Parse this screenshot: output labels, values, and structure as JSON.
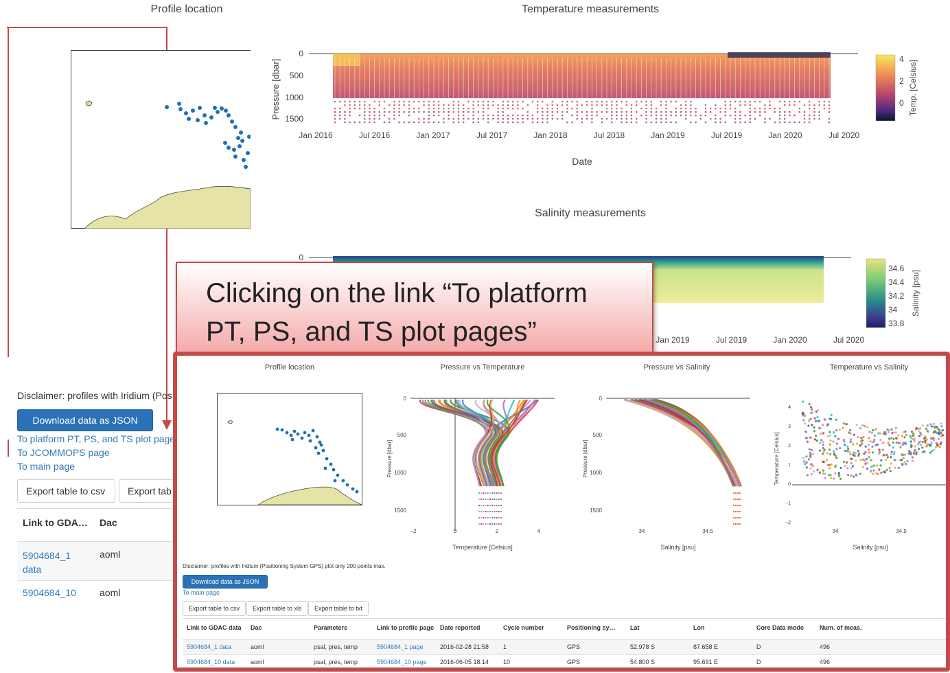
{
  "outer": {
    "map_title": "Profile location",
    "temp_title": "Temperature measurements",
    "temp_xlabel": "Date",
    "temp_ylabel": "Pressure [dbar]",
    "temp_yticks": [
      "0",
      "500",
      "1000",
      "1500"
    ],
    "temp_xticks": [
      "Jan 2016",
      "Jul 2016",
      "Jan 2017",
      "Jul 2017",
      "Jan 2018",
      "Jul 2018",
      "Jan 2019",
      "Jul 2019",
      "Jan 2020",
      "Jul 2020"
    ],
    "temp_colorbar_label": "Temp. [Celsius]",
    "temp_colorbar_ticks": [
      "4",
      "2",
      "0"
    ],
    "sal_title": "Salinity measurements",
    "sal_ytick": "0",
    "sal_xticks": [
      "Jan 2019",
      "Jul 2019",
      "Jan 2020",
      "Jul 2020"
    ],
    "sal_colorbar_label": "Salinity [psu]",
    "sal_colorbar_ticks": [
      "34.6",
      "34.4",
      "34.2",
      "34",
      "33.8"
    ],
    "disclaimer": "Disclaimer: profiles with Iridium (Pos",
    "download_label": "Download data as JSON",
    "link_platform": "To platform PT, PS, and TS plot page",
    "link_jcommops": "To JCOMMOPS page",
    "link_main": "To main page",
    "export_csv": "Export table to csv",
    "export_other": "Export tab",
    "col_link": "Link to GDA…",
    "col_dac": "Dac",
    "row1_link": "5904684_1 data",
    "row1_dac": "aoml",
    "row2_link": "5904684_10",
    "row2_dac": "aoml"
  },
  "callout": {
    "text": "Clicking on the link “To platform PT, PS, and TS plot pages”"
  },
  "inner": {
    "map_title": "Profile location",
    "pt_title": "Pressure vs Temperature",
    "ps_title": "Pressure vs Salinity",
    "ts_title": "Temperature vs Salinity",
    "pt_xlabel": "Temperature [Celsius]",
    "ps_xlabel": "Salinity [psu]",
    "ts_xlabel": "Salinity [psu]",
    "p_ylabel": "Pressure [dbar]",
    "ts_ylabel": "Temperature [Celsius]",
    "p_yticks": [
      "0",
      "500",
      "1000",
      "1500"
    ],
    "pt_xticks": [
      "−2",
      "0",
      "2",
      "4"
    ],
    "ps_xticks": [
      "34",
      "34.5"
    ],
    "ts_xticks": [
      "34",
      "34.5"
    ],
    "ts_yticks": [
      "4",
      "3",
      "2",
      "1",
      "0",
      "−1",
      "−2"
    ],
    "disclaimer": "Disclaimer: profiles with Iridium (Positioning System GPS) plot only 200 points max.",
    "download_label": "Download data as JSON",
    "link_main": "To main page",
    "export_csv": "Export table to csv",
    "export_xls": "Export table to xls",
    "export_txt": "Export table to txt",
    "columns": [
      "Link to GDAC data",
      "Dac",
      "Parameters",
      "Link to profile page",
      "Date reported",
      "Cycle number",
      "Positioning sy…",
      "Lat",
      "Lon",
      "Core Data mode",
      "Num. of meas."
    ],
    "rows": [
      [
        "5904684_1 data",
        "aoml",
        "psal, pres, temp",
        "5904684_1 page",
        "2016-02-28 21:58",
        "1",
        "GPS",
        "52.978 S",
        "87.658 E",
        "D",
        "496"
      ],
      [
        "5904684_10 data",
        "aoml",
        "psal, pres, temp",
        "5904684_10 page",
        "2016-06-05 18:14",
        "10",
        "GPS",
        "54.800 S",
        "95.691 E",
        "D",
        "496"
      ]
    ]
  },
  "colors": {
    "accent_frame": "#c44a4a",
    "button_primary": "#2a72b5",
    "link": "#337ab7",
    "map_land": "#e6e3a6",
    "track_points": "#1f6fb4"
  }
}
